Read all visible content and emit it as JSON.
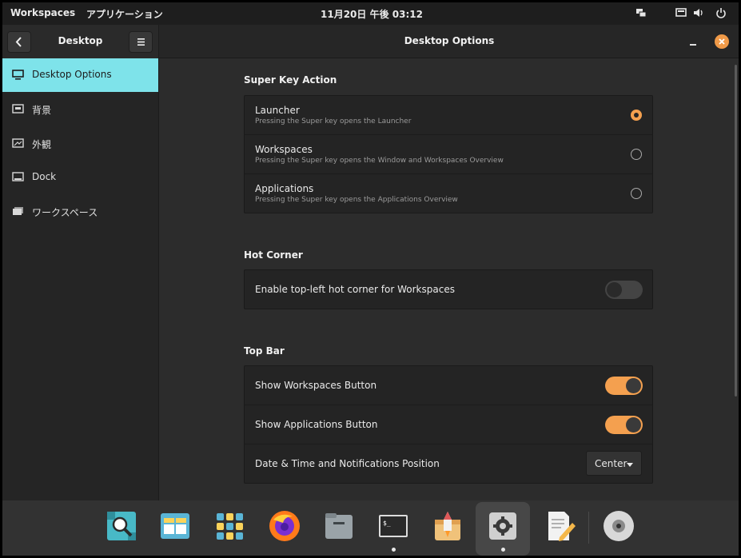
{
  "topbar": {
    "workspaces": "Workspaces",
    "applications": "アプリケーション",
    "clock": "11月20日 午後 03:12",
    "icons": [
      "network-icon",
      "display-icon",
      "volume-icon",
      "power-icon"
    ]
  },
  "window": {
    "sidebar_title": "Desktop",
    "title": "Desktop Options"
  },
  "sidebar": {
    "items": [
      {
        "label": "Desktop Options",
        "icon": "monitor-icon",
        "active": true
      },
      {
        "label": "背景",
        "icon": "wallpaper-icon",
        "active": false
      },
      {
        "label": "外観",
        "icon": "appearance-icon",
        "active": false
      },
      {
        "label": "Dock",
        "icon": "dock-icon",
        "active": false
      },
      {
        "label": "ワークスペース",
        "icon": "workspaces-icon",
        "active": false
      }
    ]
  },
  "super_key": {
    "title": "Super Key Action",
    "options": [
      {
        "title": "Launcher",
        "desc": "Pressing the Super key opens the Launcher",
        "selected": true
      },
      {
        "title": "Workspaces",
        "desc": "Pressing the Super key opens the Window and Workspaces Overview",
        "selected": false
      },
      {
        "title": "Applications",
        "desc": "Pressing the Super key opens the Applications Overview",
        "selected": false
      }
    ]
  },
  "hot_corner": {
    "title": "Hot Corner",
    "label": "Enable top-left hot corner for Workspaces",
    "enabled": false
  },
  "top_bar": {
    "title": "Top Bar",
    "show_workspaces_label": "Show Workspaces Button",
    "show_workspaces": true,
    "show_applications_label": "Show Applications Button",
    "show_applications": true,
    "position_label": "Date & Time and Notifications Position",
    "position_value": "Center"
  },
  "dock": {
    "apps": [
      {
        "name": "search-app-icon",
        "running": false
      },
      {
        "name": "workspaces-app-icon",
        "running": false
      },
      {
        "name": "applications-app-icon",
        "running": false
      },
      {
        "name": "firefox-app-icon",
        "running": false
      },
      {
        "name": "files-app-icon",
        "running": false
      },
      {
        "name": "terminal-app-icon",
        "running": true
      },
      {
        "name": "pop-shop-app-icon",
        "running": false
      },
      {
        "name": "settings-app-icon",
        "running": true,
        "active": true
      },
      {
        "name": "text-editor-app-icon",
        "running": false
      },
      {
        "name": "disc-icon",
        "running": false
      }
    ]
  },
  "colors": {
    "accent": "#f4a04f",
    "sidebar_active": "#7ee3ea",
    "close": "#f09a48"
  }
}
